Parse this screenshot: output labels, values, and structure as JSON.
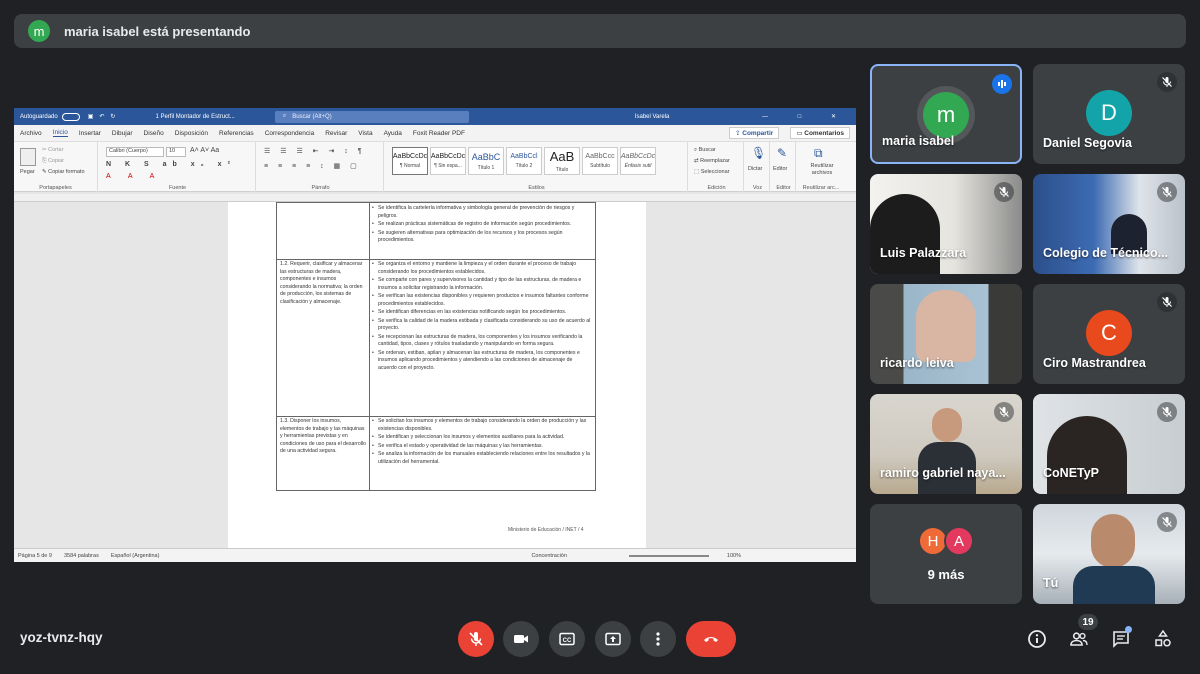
{
  "banner": {
    "avatar_letter": "m",
    "text": "maria isabel está presentando"
  },
  "word": {
    "autosave": "Autoguardado",
    "doc_title": "1 Perfil Montador de Estruct...",
    "search_placeholder": "Buscar (Alt+Q)",
    "user": "Isabel Varela",
    "menu": [
      "Archivo",
      "Inicio",
      "Insertar",
      "Dibujar",
      "Diseño",
      "Disposición",
      "Referencias",
      "Correspondencia",
      "Revisar",
      "Vista",
      "Ayuda",
      "Foxit Reader PDF"
    ],
    "share": "Compartir",
    "comments": "Comentarios",
    "clipboard": {
      "paste": "Pegar",
      "cut": "Cortar",
      "copy": "Copiar",
      "format": "Copiar formato",
      "label": "Portapapeles"
    },
    "font": {
      "name": "Calibri (Cuerpo)",
      "size": "10",
      "label": "Fuente"
    },
    "paragraph_label": "Párrafo",
    "styles": [
      {
        "preview": "AaBbCcDc",
        "name": "¶ Normal"
      },
      {
        "preview": "AaBbCcDc",
        "name": "¶ Sin espa..."
      },
      {
        "preview": "AaBbC",
        "name": "Título 1"
      },
      {
        "preview": "AaBbCcl",
        "name": "Título 2"
      },
      {
        "preview": "AaB",
        "name": "Título"
      },
      {
        "preview": "AaBbCcc",
        "name": "Subtítulo"
      },
      {
        "preview": "AaBbCcDc",
        "name": "Énfasis sutil"
      }
    ],
    "styles_label": "Estilos",
    "editing": {
      "find": "Buscar",
      "replace": "Reemplazar",
      "select": "Seleccionar",
      "label": "Edición"
    },
    "voice": {
      "dictate": "Dictar",
      "label": "Voz"
    },
    "editor": {
      "name": "Editor",
      "label": "Editor"
    },
    "reuse": {
      "name": "Reutilizar archivos",
      "label": "Reutilizar arc..."
    },
    "table": {
      "row0_bullets": [
        "Se identifica la cartelería informativa y simbología general de prevención de riesgos y peligros.",
        "Se realizan prácticas sistemáticas de registro de información según procedimientos.",
        "Se sugieren alternativas para optimización de los recursos y los procesos según procedimientos."
      ],
      "row1_left": "1.2. Requerir, clasificar y almacenar las estructuras de madera, componentes e insumos considerando la normativa; la orden de producción, los sistemas de clasificación y almacenaje.",
      "row1_bullets": [
        "Se organiza el entorno y mantiene la limpieza y el orden durante el proceso de trabajo considerando los procedimientos establecidos.",
        "Se comparte con pares y supervisores la cantidad y tipo de las estructuras, de madera e insumos a solicitar registrando la información.",
        "Se verifican las existencias disponibles y requieren productos e insumos faltantes conforme procedimientos establecidos.",
        "Se identifican diferencias en las existencias notificando según los procedimientos.",
        "Se verifica la calidad de la madera estibada y clasificada considerando su uso de acuerdo al proyecto.",
        "Se recepcionan las estructuras de madera, los componentes y los insumos verificando la cantidad, tipos, clases y rótulos trasladando y manipulando en forma segura.",
        "Se ordenan, estiban, apilan y almacenan las estructuras de madera, los componentes e insumos aplicando procedimientos y atendiendo a las condiciones de almacenaje de acuerdo con el proyecto."
      ],
      "row2_left": "1.3. Disponer los insumos, elementos de trabajo y las máquinas y herramientas previstas y en condiciones de uso para el desarrollo de una actividad segura.",
      "row2_bullets": [
        "Se solicitan los insumos y elementos de trabajo considerando la orden de producción y las existencias disponibles.",
        "Se identifican y seleccionan los insumos y elementos auxiliares para la actividad.",
        "Se verifica el estado y operatividad de las máquinas y las herramientas.",
        "Se analiza la información de los manuales estableciendo relaciones entre los resultados y la utilización del herramental."
      ]
    },
    "page_footer": "Ministerio de Educación / INET / 4",
    "status": {
      "page": "Página 5 de 9",
      "words": "3584 palabras",
      "lang": "Español (Argentina)",
      "focus": "Concentración",
      "zoom": "100%"
    }
  },
  "participants": [
    {
      "name": "maria isabel",
      "letter": "m",
      "color": "#33a852",
      "speaking": true
    },
    {
      "name": "Daniel Segovia",
      "letter": "D",
      "color": "#12a4a8"
    },
    {
      "name": "Luis Palazzara",
      "video": true
    },
    {
      "name": "Colegio de Técnico...",
      "video": true
    },
    {
      "name": "ricardo leiva",
      "video": true
    },
    {
      "name": "Ciro Mastrandrea",
      "letter": "C",
      "color": "#e8491d"
    },
    {
      "name": "ramiro gabriel naya...",
      "video": true
    },
    {
      "name": "CoNETyP",
      "video": true
    },
    {
      "name": "9 más",
      "letters": [
        "H",
        "A"
      ],
      "colors": [
        "#ee6a37",
        "#e4395f"
      ]
    },
    {
      "name": "Tú",
      "video": true
    }
  ],
  "meeting_code": "yoz-tvnz-hqy",
  "people_count": "19",
  "colors": {
    "end_call": "#ea4335",
    "muted": "#ea4335",
    "speaking": "#8ab4f8",
    "bg": "#202124"
  }
}
